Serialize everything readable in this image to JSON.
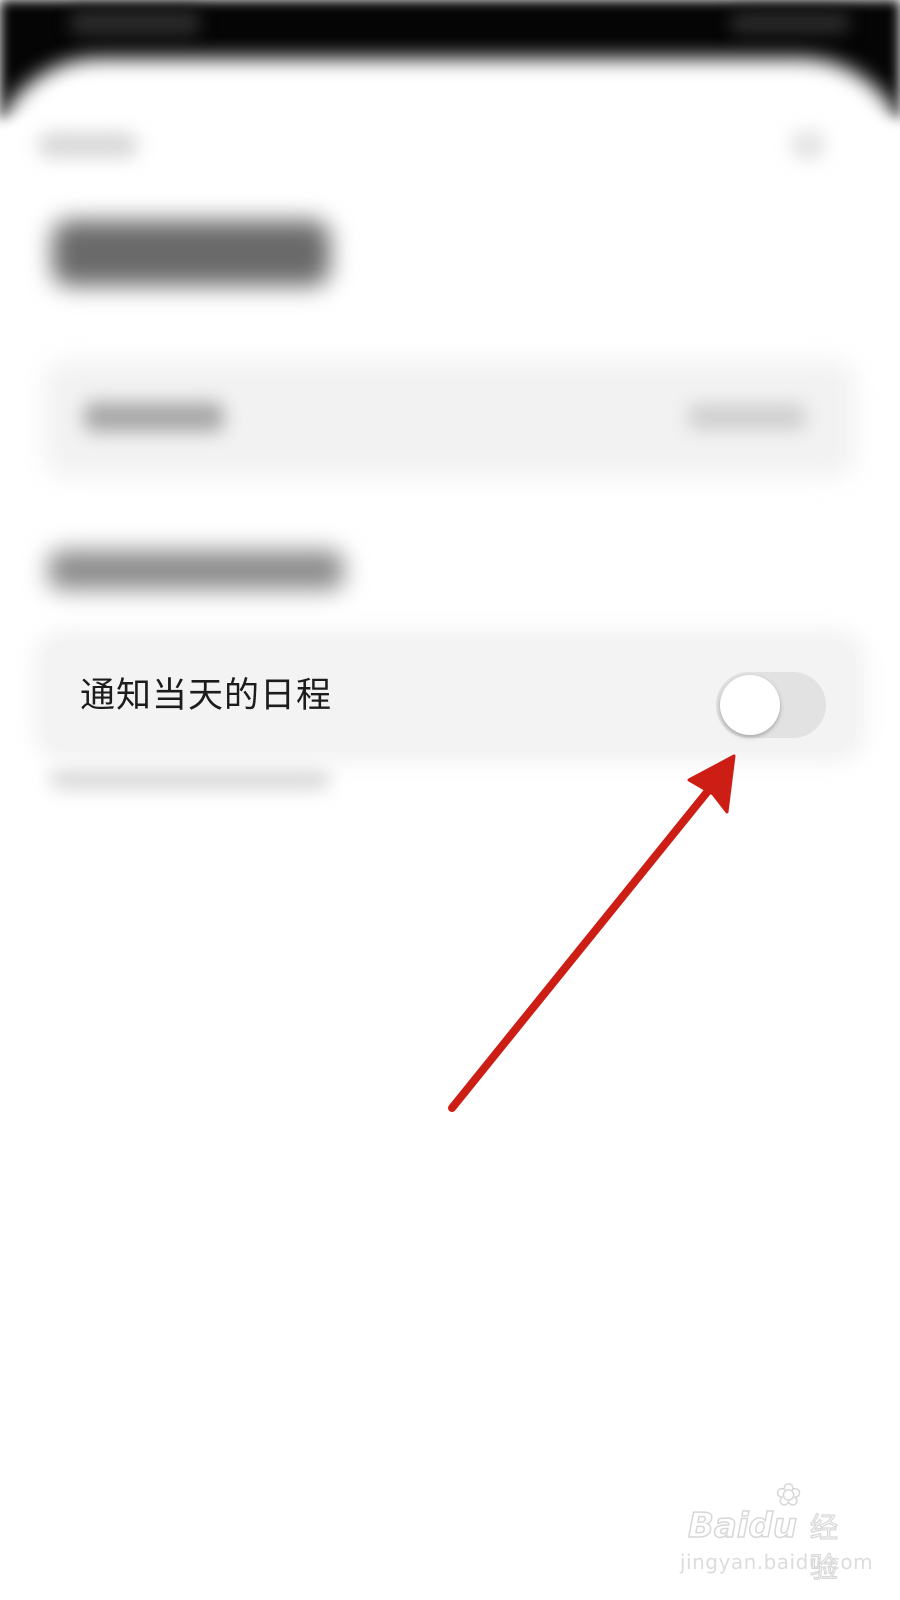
{
  "setting_row": {
    "label": "通知当天的日程",
    "toggle_on": false
  },
  "annotation": {
    "arrow_color": "#cc1e14"
  },
  "watermark": {
    "logo": "Bai",
    "logo_tail": "du",
    "logo_suffix": "经验",
    "url": "jingyan.baidu.com"
  },
  "colors": {
    "card_background": "#f3f3f3",
    "toggle_off_track": "#e2e2e2",
    "status_bar": "#050505"
  }
}
